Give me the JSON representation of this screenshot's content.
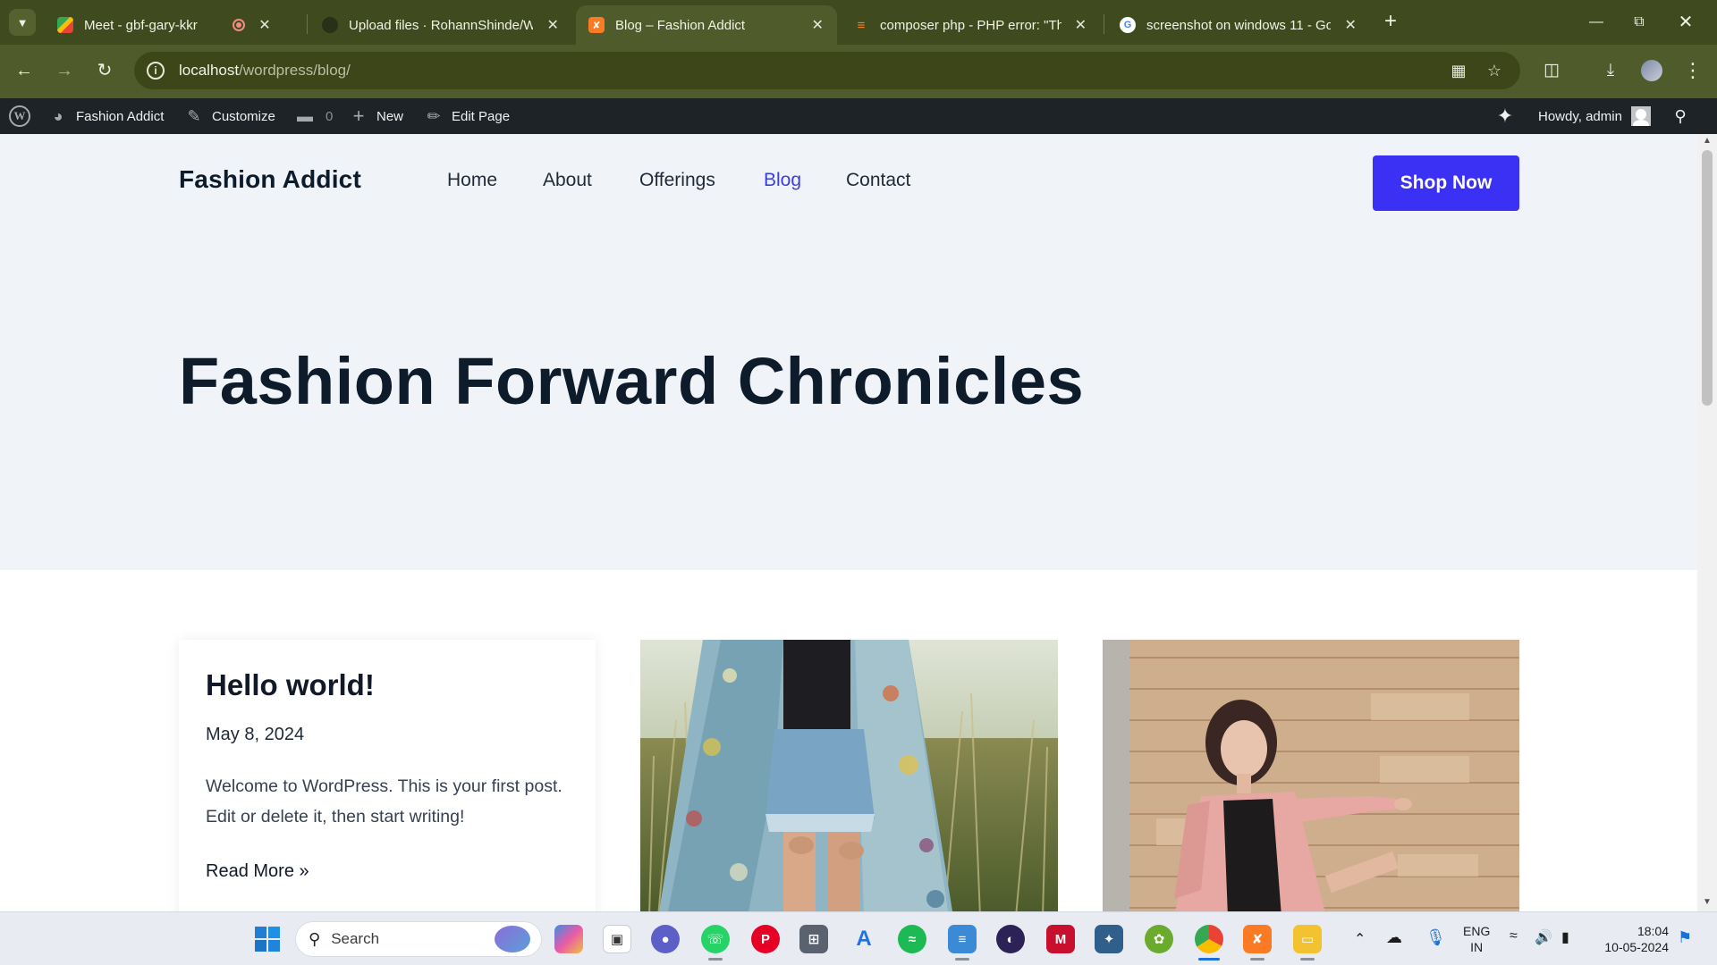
{
  "browser": {
    "tabs": [
      {
        "title": "Meet - gbf-gary-kkr",
        "active": false,
        "recording": true
      },
      {
        "title": "Upload files · RohannShinde/W",
        "active": false
      },
      {
        "title": "Blog – Fashion Addict",
        "active": true
      },
      {
        "title": "composer php - PHP error: \"The",
        "active": false
      },
      {
        "title": "screenshot on windows 11 - Go",
        "active": false
      }
    ],
    "url_host": "localhost",
    "url_path": "/wordpress/blog/",
    "colors": {
      "frame": "#3f4a1e",
      "toolbar": "#4f5b2a"
    }
  },
  "admin_bar": {
    "site_name": "Fashion Addict",
    "customize": "Customize",
    "comments_count": "0",
    "new": "New",
    "edit_page": "Edit Page",
    "greeting": "Howdy, admin"
  },
  "site": {
    "brand": "Fashion Addict",
    "menu": [
      "Home",
      "About",
      "Offerings",
      "Blog",
      "Contact"
    ],
    "current_menu": "Blog",
    "cta": "Shop Now",
    "hero_title": "Fashion Forward Chronicles",
    "colors": {
      "accent": "#3b31f5",
      "hero_bg": "#f0f3f8",
      "text": "#0d1b2a"
    }
  },
  "posts": [
    {
      "title": "Hello world!",
      "date": "May 8, 2024",
      "excerpt": "Welcome to WordPress. This is your first post. Edit or delete it, then start writing!",
      "read_more": "Read More »"
    }
  ],
  "taskbar": {
    "search_placeholder": "Search",
    "language": "ENG",
    "region": "IN",
    "time": "18:04",
    "date": "10-05-2024"
  }
}
